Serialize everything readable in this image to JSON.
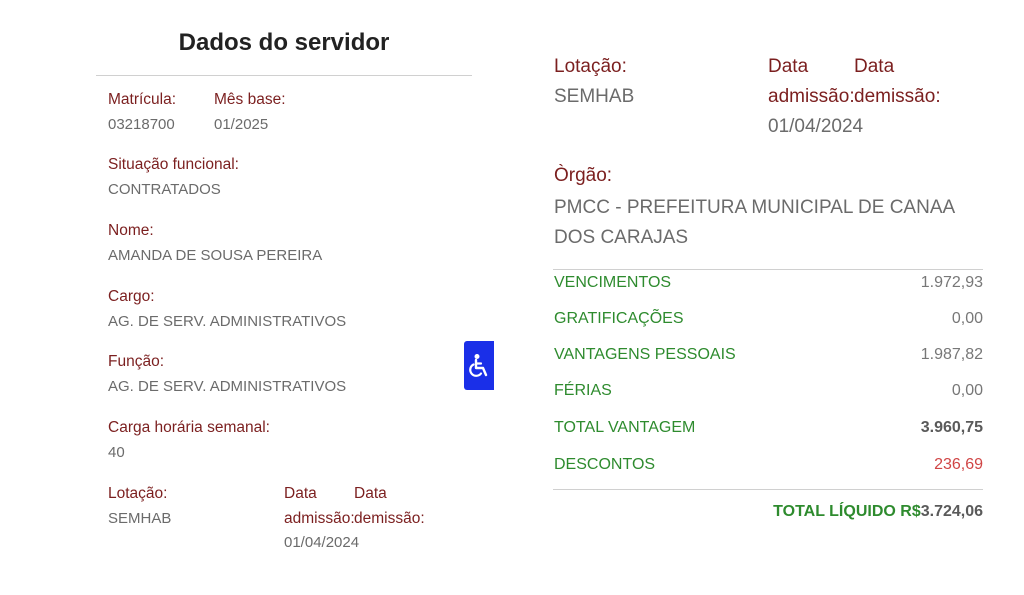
{
  "left": {
    "title": "Dados do servidor",
    "matricula": {
      "label": "Matrícula:",
      "value": "03218700"
    },
    "mes_base": {
      "label": "Mês base:",
      "value": "01/2025"
    },
    "situacao": {
      "label": "Situação funcional:",
      "value": "CONTRATADOS"
    },
    "nome": {
      "label": "Nome:",
      "value": "AMANDA DE SOUSA PEREIRA"
    },
    "cargo": {
      "label": "Cargo:",
      "value": "AG. DE SERV. ADMINISTRATIVOS"
    },
    "funcao": {
      "label": "Função:",
      "value": "AG. DE SERV. ADMINISTRATIVOS"
    },
    "carga": {
      "label": "Carga horária semanal:",
      "value": "40"
    },
    "lotacao": {
      "label": "Lotação:",
      "value": "SEMHAB"
    },
    "data_adm": {
      "label_top": "Data",
      "label_bottom": "admissão:",
      "value": "01/04/2024"
    },
    "data_dem": {
      "label_top": "Data",
      "label_bottom": "demissão:"
    }
  },
  "right": {
    "lotacao": {
      "label": "Lotação:",
      "value": "SEMHAB"
    },
    "data_adm": {
      "label_top": "Data",
      "label_bottom": "admissão:",
      "value": "01/04/2024"
    },
    "data_dem": {
      "label_top": "Data",
      "label_bottom": "demissão:"
    },
    "orgao": {
      "label": "Òrgão:",
      "value": "PMCC - PREFEITURA MUNICIPAL DE CANAA DOS CARAJAS"
    },
    "rows": [
      {
        "name": "VENCIMENTOS",
        "value": "1.972,93"
      },
      {
        "name": "GRATIFICAÇÕES",
        "value": "0,00"
      },
      {
        "name": "VANTAGENS PESSOAIS",
        "value": "1.987,82"
      },
      {
        "name": "FÉRIAS",
        "value": "0,00"
      },
      {
        "name": "TOTAL VANTAGEM",
        "value": "3.960,75"
      },
      {
        "name": "DESCONTOS",
        "value": "236,69"
      }
    ],
    "total_liquido": {
      "label": "TOTAL LÍQUIDO R$",
      "value": "3.724,06"
    }
  },
  "accessibility": {
    "icon": "wheelchair-icon",
    "color": "#1a2fe8"
  },
  "colors": {
    "label": "#7b1f1f",
    "value": "#6b6b6b",
    "green": "#2e8b2e",
    "red": "#d04545"
  }
}
